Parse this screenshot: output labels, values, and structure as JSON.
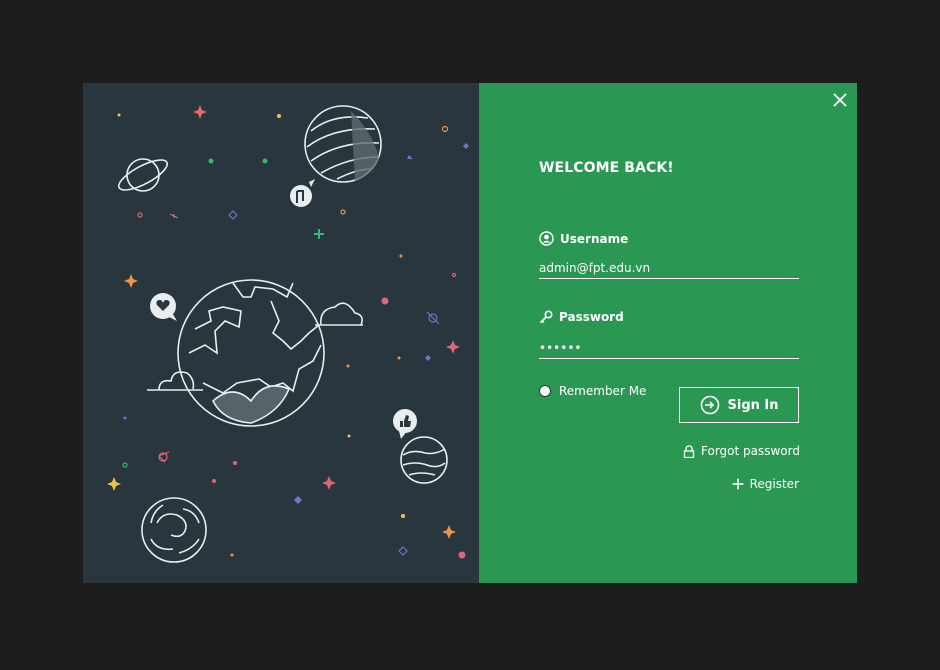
{
  "dialog": {
    "close_icon": "close-icon",
    "colors": {
      "panel": "#2a9853",
      "illustration_bg": "#29363d",
      "page_bg": "#1d1d1d"
    }
  },
  "illustration": {
    "description_icons": [
      "saturn-icon",
      "planet-icon",
      "earth-icon",
      "heart-bubble-icon",
      "like-bubble-icon",
      "cloud-icon",
      "star-icon"
    ]
  },
  "form": {
    "welcome": "WELCOME BACK!",
    "username": {
      "label": "Username",
      "icon": "user-circle-icon",
      "value": "admin@fpt.edu.vn"
    },
    "password": {
      "label": "Password",
      "icon": "key-icon",
      "value": "••••••"
    },
    "remember_label": "Remember Me",
    "sign_in_label": "Sign In",
    "forgot_label": "Forgot password",
    "register_label": "Register"
  }
}
